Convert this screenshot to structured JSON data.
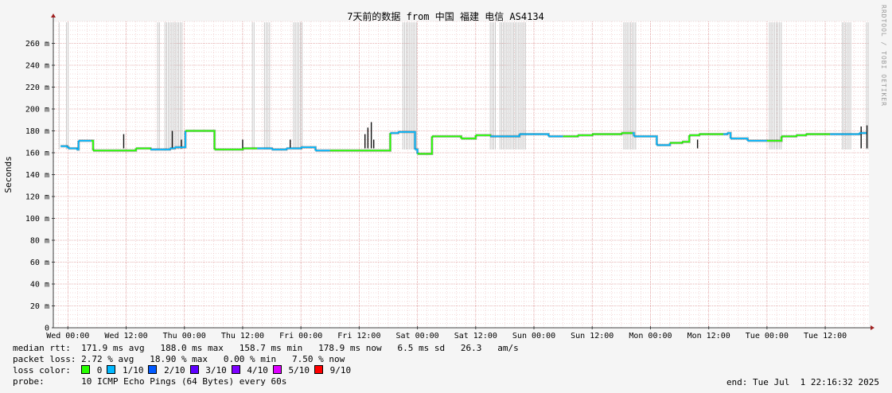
{
  "chart_data": {
    "type": "line",
    "title": "7天前的数据 from 中国 福建 电信 AS4134",
    "ylabel": "Seconds",
    "ylim": [
      0,
      0.28
    ],
    "yticks": [
      0,
      0.02,
      0.04,
      0.06,
      0.08,
      0.1,
      0.12,
      0.14,
      0.16,
      0.18,
      0.2,
      0.22,
      0.24,
      0.26
    ],
    "ytick_labels": [
      "0",
      "20 m",
      "40 m",
      "60 m",
      "80 m",
      "100 m",
      "120 m",
      "140 m",
      "160 m",
      "180 m",
      "200 m",
      "220 m",
      "240 m",
      "260 m"
    ],
    "xlim_hours": [
      -3,
      165
    ],
    "xticks": [
      0,
      12,
      24,
      36,
      48,
      60,
      72,
      84,
      96,
      108,
      120,
      132,
      144,
      156
    ],
    "xtick_labels": [
      "Wed 00:00",
      "Wed 12:00",
      "Thu 00:00",
      "Thu 12:00",
      "Fri 00:00",
      "Fri 12:00",
      "Sat 00:00",
      "Sat 12:00",
      "Sun 00:00",
      "Sun 12:00",
      "Mon 00:00",
      "Mon 12:00",
      "Tue 00:00",
      "Tue 12:00"
    ],
    "grid": true,
    "median_rtt": {
      "x_hours": [
        -1.5,
        -0.2,
        0.1,
        1.8,
        2.2,
        4.8,
        5.2,
        8,
        11,
        14,
        17,
        19,
        21,
        22,
        23.8,
        24.2,
        28.5,
        30.2,
        33,
        36,
        39,
        42,
        45,
        48,
        51,
        54,
        57,
        60,
        63.5,
        65.8,
        66.4,
        68,
        70,
        71,
        71.5,
        72,
        75,
        78.7,
        81,
        84,
        87,
        90,
        93,
        96,
        99,
        102,
        105,
        108,
        111,
        114,
        116.3,
        116.6,
        119,
        120.8,
        121.3,
        124,
        126.5,
        128,
        130,
        132,
        135,
        135.8,
        136.5,
        140,
        143.5,
        144,
        147,
        150,
        152,
        154,
        157,
        160,
        163,
        164.5
      ],
      "y_seconds": [
        0.166,
        0.165,
        0.164,
        0.163,
        0.171,
        0.171,
        0.162,
        0.162,
        0.162,
        0.164,
        0.163,
        0.163,
        0.164,
        0.165,
        0.165,
        0.18,
        0.18,
        0.163,
        0.163,
        0.164,
        0.164,
        0.163,
        0.164,
        0.165,
        0.162,
        0.162,
        0.162,
        0.162,
        0.162,
        0.162,
        0.178,
        0.179,
        0.179,
        0.179,
        0.163,
        0.159,
        0.175,
        0.175,
        0.173,
        0.176,
        0.175,
        0.175,
        0.177,
        0.177,
        0.175,
        0.175,
        0.176,
        0.177,
        0.177,
        0.178,
        0.178,
        0.175,
        0.175,
        0.175,
        0.167,
        0.169,
        0.17,
        0.176,
        0.177,
        0.177,
        0.177,
        0.178,
        0.173,
        0.171,
        0.171,
        0.171,
        0.175,
        0.176,
        0.177,
        0.177,
        0.177,
        0.177,
        0.178,
        0.178
      ],
      "loss_color_by_segment": [
        "1/10",
        "0",
        "1/10",
        "0",
        "1/10",
        "0",
        "1/10",
        "0",
        "1/10",
        "0",
        "1/10",
        "0",
        "1/10",
        "0",
        "1/10"
      ]
    },
    "packet_loss_spikes_hours": [
      [
        -1.8,
        -1.5
      ],
      [
        -0.3,
        0.3
      ],
      [
        18.5,
        19.2
      ],
      [
        20,
        23.6
      ],
      [
        38,
        38.4
      ],
      [
        40.5,
        41.6
      ],
      [
        46.5,
        48.5
      ],
      [
        69,
        72
      ],
      [
        87,
        88.2
      ],
      [
        89,
        94.5
      ],
      [
        114.5,
        117
      ],
      [
        144.5,
        147
      ],
      [
        159.5,
        161.5
      ],
      [
        164.5,
        165
      ]
    ],
    "rtt_spikes_hours": [
      [
        11.5,
        0.177
      ],
      [
        21.5,
        0.18
      ],
      [
        23.4,
        0.172
      ],
      [
        36,
        0.172
      ],
      [
        45.8,
        0.172
      ],
      [
        61.2,
        0.177
      ],
      [
        61.8,
        0.183
      ],
      [
        62.5,
        0.188
      ],
      [
        63.0,
        0.172
      ],
      [
        129.7,
        0.172
      ],
      [
        163.4,
        0.184
      ],
      [
        164.6,
        0.185
      ]
    ]
  },
  "legend": {
    "median_rtt_label": "median rtt:",
    "median_rtt_stats": "171.9 ms avg   188.0 ms max   158.7 ms min   178.9 ms now   6.5 ms sd   26.3   am/s",
    "packet_loss_label": "packet loss:",
    "packet_loss_stats": "2.72 % avg   18.90 % max   0.00 % min   7.50 % now",
    "loss_color_label": "loss color:",
    "loss_colors": [
      {
        "label": "0",
        "color": "#26ff00"
      },
      {
        "label": "1/10",
        "color": "#00b8ff"
      },
      {
        "label": "2/10",
        "color": "#0059ff"
      },
      {
        "label": "3/10",
        "color": "#5e00ff"
      },
      {
        "label": "4/10",
        "color": "#7e00ff"
      },
      {
        "label": "5/10",
        "color": "#dd00ff"
      },
      {
        "label": "9/10",
        "color": "#ff0000"
      }
    ],
    "probe_label": "probe:",
    "probe_text": "10 ICMP Echo Pings (64 Bytes) every 60s",
    "end_text": "end: Tue Jul  1 22:16:32 2025"
  },
  "watermark": "RRDTOOL / TOBI OETIKER",
  "colors": {
    "grid_minor": "#e8b4b4",
    "grid_major": "#d98c8c",
    "loss_band": "#c8c8c8",
    "axis": "#404040",
    "arrow": "#a02020"
  }
}
